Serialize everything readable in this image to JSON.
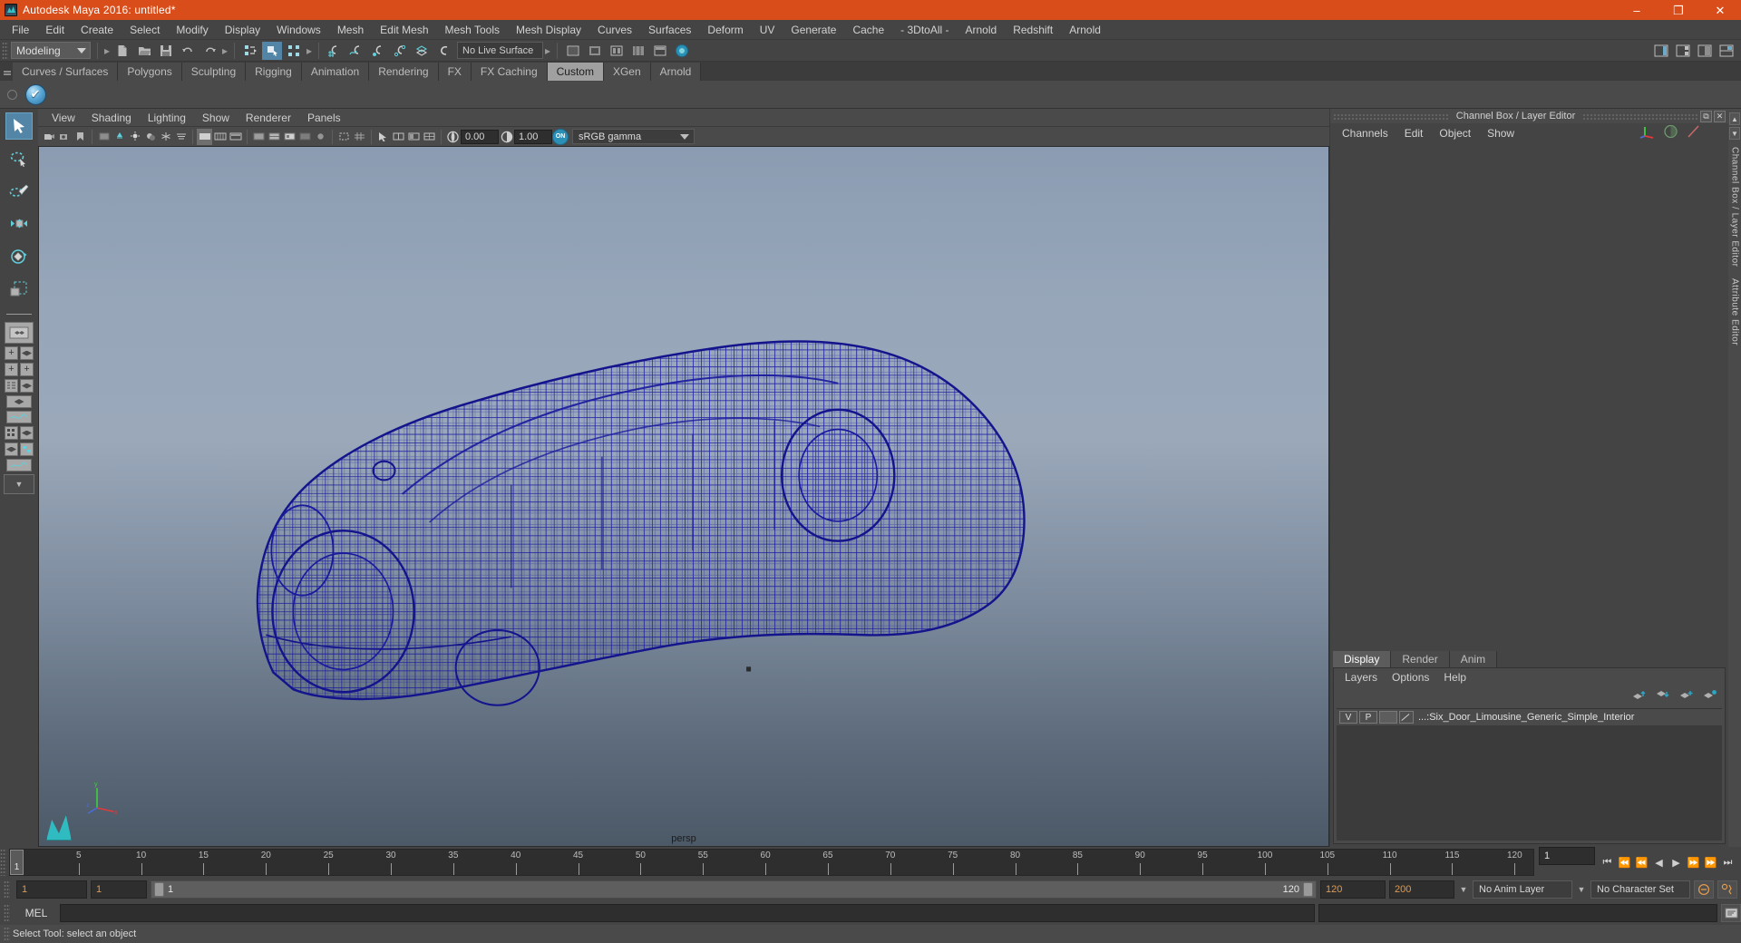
{
  "window": {
    "title": "Autodesk Maya 2016: untitled*",
    "minimize": "–",
    "maximize": "❐",
    "close": "✕",
    "titlebar_color": "#d94d1a"
  },
  "menubar": {
    "items": [
      {
        "label": "File"
      },
      {
        "label": "Edit"
      },
      {
        "label": "Create"
      },
      {
        "label": "Select"
      },
      {
        "label": "Modify"
      },
      {
        "label": "Display"
      },
      {
        "label": "Windows"
      },
      {
        "label": "Mesh"
      },
      {
        "label": "Edit Mesh"
      },
      {
        "label": "Mesh Tools"
      },
      {
        "label": "Mesh Display"
      },
      {
        "label": "Curves"
      },
      {
        "label": "Surfaces"
      },
      {
        "label": "Deform"
      },
      {
        "label": "UV"
      },
      {
        "label": "Generate"
      },
      {
        "label": "Cache"
      },
      {
        "label": "- 3DtoAll -"
      },
      {
        "label": "Arnold"
      },
      {
        "label": "Redshift"
      },
      {
        "label": "Arnold"
      }
    ]
  },
  "toolbar": {
    "mode_menu": "Modeling",
    "live_surface": "No Live Surface"
  },
  "shelf": {
    "tabs": [
      {
        "label": "Curves / Surfaces",
        "active": false
      },
      {
        "label": "Polygons",
        "active": false
      },
      {
        "label": "Sculpting",
        "active": false
      },
      {
        "label": "Rigging",
        "active": false
      },
      {
        "label": "Animation",
        "active": false
      },
      {
        "label": "Rendering",
        "active": false
      },
      {
        "label": "FX",
        "active": false
      },
      {
        "label": "FX Caching",
        "active": false
      },
      {
        "label": "Custom",
        "active": true
      },
      {
        "label": "XGen",
        "active": false
      },
      {
        "label": "Arnold",
        "active": false
      }
    ]
  },
  "viewport": {
    "menu": [
      "View",
      "Shading",
      "Lighting",
      "Show",
      "Renderer",
      "Panels"
    ],
    "exposure": "0.00",
    "gamma": "1.00",
    "color_profile": "sRGB gamma",
    "on_badge": "ON",
    "camera_label": "persp",
    "model_color": "#1a1a9e"
  },
  "channel_box": {
    "panel_title": "Channel Box / Layer Editor",
    "menu": [
      "Channels",
      "Edit",
      "Object",
      "Show"
    ],
    "tabs": [
      {
        "label": "Display",
        "active": true
      },
      {
        "label": "Render",
        "active": false
      },
      {
        "label": "Anim",
        "active": false
      }
    ],
    "layer_menu": [
      "Layers",
      "Options",
      "Help"
    ],
    "layers": [
      {
        "visibility": "V",
        "playback": "P",
        "name": "...:Six_Door_Limousine_Generic_Simple_Interior"
      }
    ]
  },
  "vertical_tabs": [
    "Channel Box / Layer Editor",
    "Attribute Editor"
  ],
  "timeline": {
    "current_frame": "1",
    "start_label": "1",
    "ticks": [
      5,
      10,
      15,
      20,
      25,
      30,
      35,
      40,
      45,
      50,
      55,
      60,
      65,
      70,
      75,
      80,
      85,
      90,
      95,
      100,
      105,
      110,
      115,
      120
    ],
    "frame_field": "1",
    "range_start": "1",
    "range_end": "1",
    "slider_start": "1",
    "slider_end": "120",
    "playback_end": "120",
    "animation_end": "200",
    "anim_layer": "No Anim Layer",
    "character_set": "No Character Set"
  },
  "command_line": {
    "language": "MEL",
    "command": "",
    "output": ""
  },
  "statusbar": {
    "message": "Select Tool: select an object"
  }
}
